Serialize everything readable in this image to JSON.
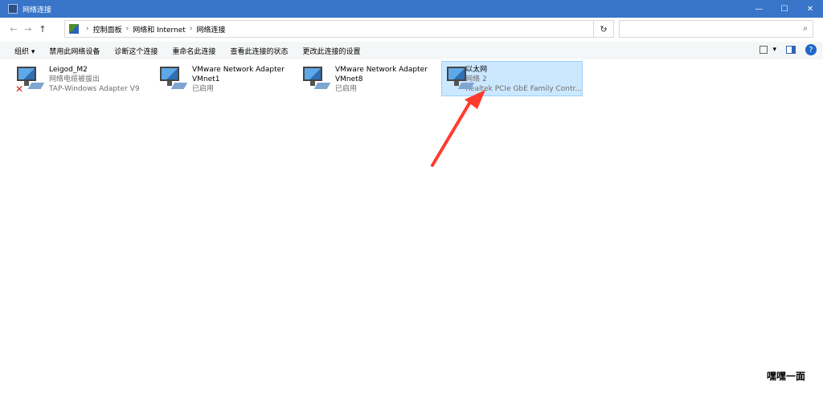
{
  "window": {
    "title": "网络连接",
    "buttons": {
      "minimize": "—",
      "maximize": "☐",
      "close": "✕"
    }
  },
  "navigation": {
    "back_icon": "←",
    "forward_icon": "→",
    "up_icon": "↑",
    "breadcrumbs": [
      "控制面板",
      "网络和 Internet",
      "网络连接"
    ],
    "separator": "›",
    "dropdown_icon": "⌄",
    "refresh_icon": "↻",
    "search_icon": "⌕",
    "search_placeholder": ""
  },
  "toolbar": {
    "items": [
      "组织 ▾",
      "禁用此网络设备",
      "诊断这个连接",
      "重命名此连接",
      "查看此连接的状态",
      "更改此连接的设置"
    ],
    "view_icon": "view-options",
    "view_dropdown": "▾",
    "pane_icon": "preview-pane",
    "help_label": "?"
  },
  "connections": [
    {
      "name": "Leigod_M2",
      "line2": "网络电缆被拔出",
      "line3": "TAP-Windows Adapter V9",
      "disconnected": true,
      "selected": false
    },
    {
      "name": "VMware Network Adapter",
      "line2": "VMnet1",
      "line3": "已启用",
      "disconnected": false,
      "selected": false
    },
    {
      "name": "VMware Network Adapter",
      "line2": "VMnet8",
      "line3": "已启用",
      "disconnected": false,
      "selected": false
    },
    {
      "name": "以太网",
      "line2": "网络 2",
      "line3": "Realtek PCIe GbE Family Contr...",
      "disconnected": false,
      "selected": true
    }
  ],
  "annotation_arrow_color": "#ff3b30",
  "watermark": "嘿嘿一面"
}
